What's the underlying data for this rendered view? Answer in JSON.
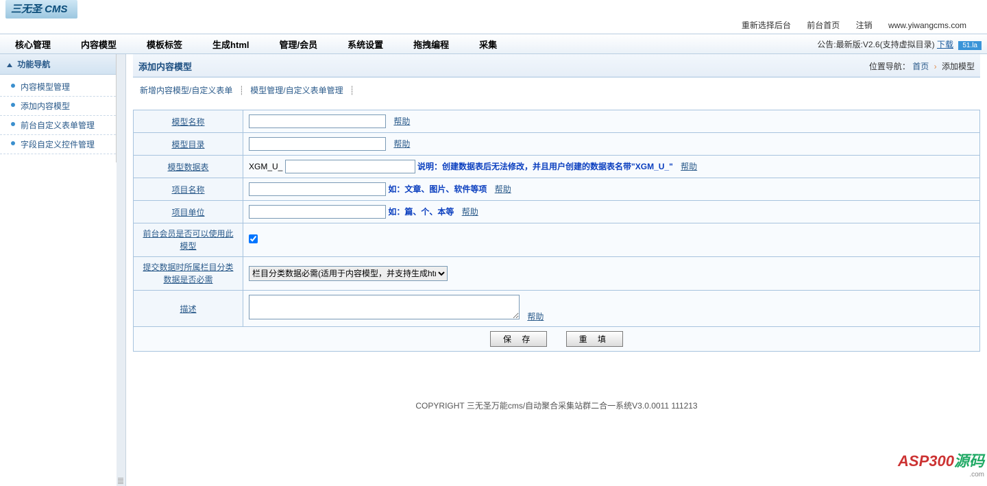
{
  "brand": "三无圣 CMS",
  "toplinks": {
    "reselect": "重新选择后台",
    "front": "前台首页",
    "logout": "注销",
    "site": "www.yiwangcms.com"
  },
  "menu": {
    "items": [
      "核心管理",
      "内容模型",
      "模板标签",
      "生成html",
      "管理/会员",
      "系统设置",
      "拖拽编程",
      "采集"
    ],
    "notice_pre": "公告:最新版:V2.6(支持虚拟目录)",
    "notice_link": "下载",
    "badge": "51.la"
  },
  "side": {
    "title": "功能导航",
    "items": [
      "内容模型管理",
      "添加内容模型",
      "前台自定义表单管理",
      "字段自定义控件管理"
    ]
  },
  "page": {
    "title": "添加内容模型",
    "crumb_pre": "位置导航：",
    "crumb_home": "首页",
    "crumb_leaf": "添加模型"
  },
  "subnav": {
    "a": "新增内容模型/自定义表单",
    "b": "模型管理/自定义表单管理"
  },
  "labels": {
    "name": "模型名称",
    "dir": "模型目录",
    "table": "模型数据表",
    "item_name": "项目名称",
    "item_unit": "项目单位",
    "front_use": "前台会员是否可以使用此模型",
    "submit_need": "提交数据时所属栏目分类数据是否必需",
    "desc": "描述",
    "help": "帮助"
  },
  "hints": {
    "table_prefix": "XGM_U_",
    "table_note": "说明：创建数据表后无法修改，并且用户创建的数据表名带\"XGM_U_\"",
    "item_name_eg": "如：文章、图片、软件等项",
    "item_unit_eg": "如：篇、个、本等"
  },
  "select": {
    "opt": "栏目分类数据必需(适用于内容模型，并支持生成html)"
  },
  "buttons": {
    "save": "保 存",
    "reset": "重 填"
  },
  "footer": "COPYRIGHT 三无圣万能cms/自动聚合采集站群二合一系统V3.0.0011 111213",
  "watermark": {
    "main": "ASP300",
    "suf": "源码",
    "sub": ".com"
  }
}
